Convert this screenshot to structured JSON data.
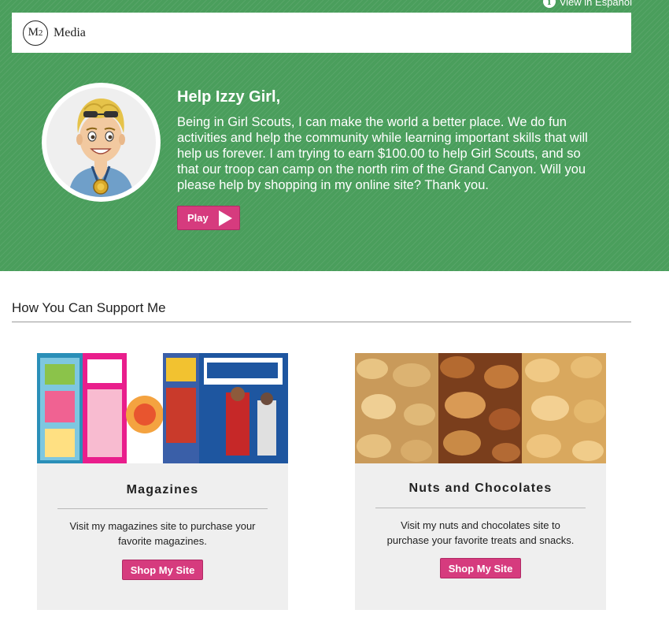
{
  "header": {
    "language_link": "View in Español",
    "logo_mark": "M",
    "logo_mark_sub": "2",
    "logo_text": "Media"
  },
  "hero": {
    "greeting": "Help Izzy Girl,",
    "message": "Being in Girl Scouts, I can make the world a better place. We do fun activities and help the community while learning important skills that will help us forever. I am trying to earn $100.00 to help Girl Scouts, and so that our troop can camp on the north rim of the Grand Canyon. Will you please help by shopping in my online site? Thank you.",
    "play_label": "Play",
    "background_color": "#4a9e5c",
    "accent_color": "#d63b7e"
  },
  "support": {
    "title": "How You Can Support Me",
    "cards": [
      {
        "title": "Magazines",
        "description": "Visit my magazines site to purchase your favorite magazines.",
        "button": "Shop My Site"
      },
      {
        "title": "Nuts and Chocolates",
        "description": "Visit my nuts and chocolates site to purchase your favorite treats and snacks.",
        "button": "Shop My Site"
      }
    ]
  }
}
